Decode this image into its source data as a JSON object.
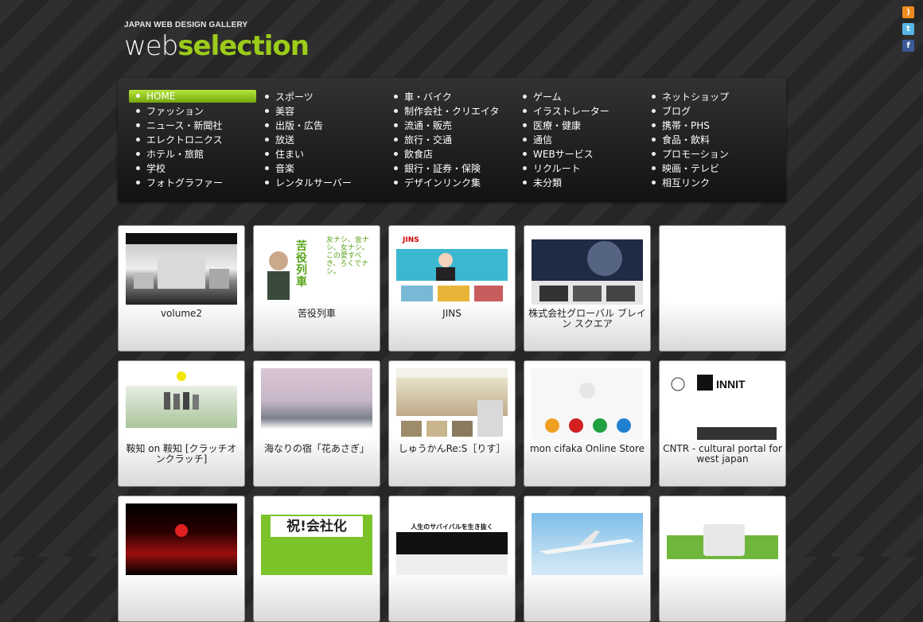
{
  "header": {
    "tagline": "JAPAN WEB DESIGN GALLERY",
    "logo_part1": "web",
    "logo_part2": "selection"
  },
  "social": [
    {
      "icon": "rss-icon",
      "glyph": ")",
      "color": "#f08c1e"
    },
    {
      "icon": "twitter-icon",
      "glyph": "t",
      "color": "#57b6e3"
    },
    {
      "icon": "facebook-icon",
      "glyph": "f",
      "color": "#3b5998"
    }
  ],
  "nav": {
    "columns": [
      [
        "HOME",
        "ファッション",
        "ニュース・新聞社",
        "エレクトロニクス",
        "ホテル・旅館",
        "学校",
        "フォトグラファー"
      ],
      [
        "スポーツ",
        "美容",
        "出版・広告",
        "放送",
        "住まい",
        "音楽",
        "レンタルサーバー"
      ],
      [
        "車・バイク",
        "制作会社・クリエイタ",
        "流通・販売",
        "旅行・交通",
        "飲食店",
        "銀行・証券・保険",
        "デザインリンク集"
      ],
      [
        "ゲーム",
        "イラストレーター",
        "医療・健康",
        "通信",
        "WEBサービス",
        "リクルート",
        "未分類"
      ],
      [
        "ネットショップ",
        "ブログ",
        "携帯・PHS",
        "食品・飲料",
        "プロモーション",
        "映画・テレビ",
        "相互リンク"
      ]
    ],
    "active": "HOME",
    "accent": "#9ccc1a"
  },
  "gallery": [
    {
      "caption": "volume2"
    },
    {
      "caption": "苦役列車",
      "thumb_text": "苦役列車",
      "thumb_text2": "友ナシ、金ナシ、女ナシ。この愛すべき、ろくでナシ。"
    },
    {
      "caption": "JINS",
      "thumb_text": "JINS"
    },
    {
      "caption": "株式会社グローバル ブレイン スクエア"
    },
    {
      "caption": ""
    },
    {
      "caption": "鞍知 on 鞍知 [クラッチオンクラッチ]"
    },
    {
      "caption": "海なりの宿「花あさぎ」"
    },
    {
      "caption": "しゅうかんRe:S［りす］"
    },
    {
      "caption": "mon cifaka Online Store"
    },
    {
      "caption": "CNTR - cultural portal for west japan",
      "thumb_text": "INNIT"
    },
    {
      "caption": ""
    },
    {
      "caption": "",
      "thumb_text": "祝!会社化"
    },
    {
      "caption": "",
      "thumb_text": "人生のサバイバルを生き抜く"
    },
    {
      "caption": ""
    },
    {
      "caption": ""
    }
  ]
}
